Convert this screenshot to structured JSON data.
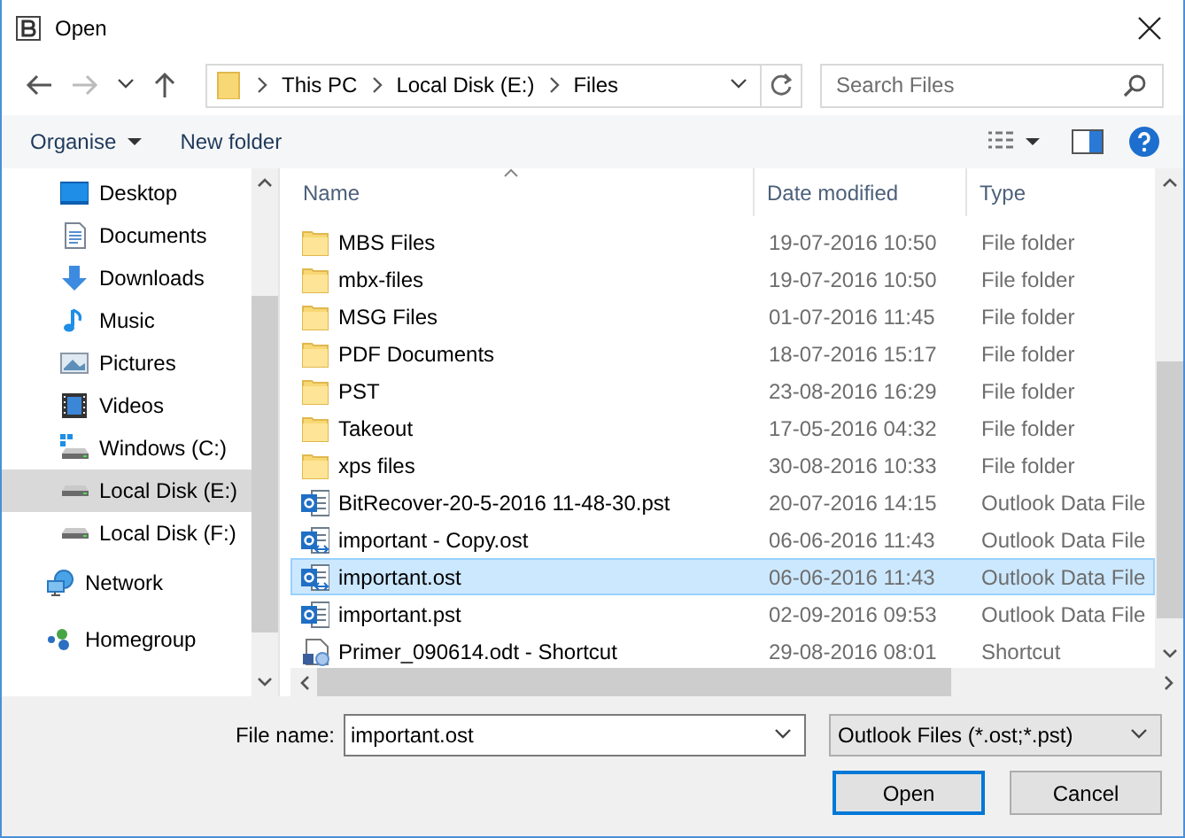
{
  "window": {
    "title": "Open"
  },
  "address": {
    "crumbs": [
      "This PC",
      "Local Disk (E:)",
      "Files"
    ]
  },
  "search": {
    "placeholder": "Search Files"
  },
  "toolbar": {
    "buttons": [
      "Organise",
      "New folder"
    ]
  },
  "sidebar": {
    "items": [
      {
        "label": "Desktop",
        "kind": "desktop",
        "selected": false
      },
      {
        "label": "Documents",
        "kind": "documents",
        "selected": false
      },
      {
        "label": "Downloads",
        "kind": "downloads",
        "selected": false
      },
      {
        "label": "Music",
        "kind": "music",
        "selected": false
      },
      {
        "label": "Pictures",
        "kind": "pictures",
        "selected": false
      },
      {
        "label": "Videos",
        "kind": "videos",
        "selected": false
      },
      {
        "label": "Windows (C:)",
        "kind": "system-drive",
        "selected": false
      },
      {
        "label": "Local Disk (E:)",
        "kind": "drive",
        "selected": true
      },
      {
        "label": "Local Disk (F:)",
        "kind": "drive",
        "selected": false
      },
      {
        "label": "Network",
        "kind": "network",
        "selected": false
      },
      {
        "label": "Homegroup",
        "kind": "homegroup",
        "selected": false
      }
    ]
  },
  "table": {
    "columns": [
      "Name",
      "Date modified",
      "Type"
    ],
    "rows": [
      {
        "name": "MBS Files",
        "date": "19-07-2016 10:50",
        "type": "File folder",
        "kind": "folder",
        "selected": false
      },
      {
        "name": "mbx-files",
        "date": "19-07-2016 10:50",
        "type": "File folder",
        "kind": "folder",
        "selected": false
      },
      {
        "name": "MSG Files",
        "date": "01-07-2016 11:45",
        "type": "File folder",
        "kind": "folder",
        "selected": false
      },
      {
        "name": "PDF Documents",
        "date": "18-07-2016 15:17",
        "type": "File folder",
        "kind": "folder",
        "selected": false
      },
      {
        "name": "PST",
        "date": "23-08-2016 16:29",
        "type": "File folder",
        "kind": "folder",
        "selected": false
      },
      {
        "name": "Takeout",
        "date": "17-05-2016 04:32",
        "type": "File folder",
        "kind": "folder",
        "selected": false
      },
      {
        "name": "xps files",
        "date": "30-08-2016 10:33",
        "type": "File folder",
        "kind": "folder",
        "selected": false
      },
      {
        "name": "BitRecover-20-5-2016 11-48-30.pst",
        "date": "20-07-2016 14:15",
        "type": "Outlook Data File",
        "kind": "data-file",
        "selected": false
      },
      {
        "name": "important - Copy.ost",
        "date": "06-06-2016 11:43",
        "type": "Outlook Data File",
        "kind": "offline-file",
        "selected": false
      },
      {
        "name": "important.ost",
        "date": "06-06-2016 11:43",
        "type": "Outlook Data File",
        "kind": "offline-file",
        "selected": true
      },
      {
        "name": "important.pst",
        "date": "02-09-2016 09:53",
        "type": "Outlook Data File",
        "kind": "data-file",
        "selected": false
      },
      {
        "name": "Primer_090614.odt - Shortcut",
        "date": "29-08-2016 08:01",
        "type": "Shortcut",
        "kind": "shortcut",
        "selected": false
      }
    ]
  },
  "file_name": {
    "label": "File name:",
    "value": "important.ost"
  },
  "file_type": {
    "value": "Outlook Files (*.ost;*.pst)"
  },
  "buttons": [
    "Open",
    "Cancel"
  ]
}
